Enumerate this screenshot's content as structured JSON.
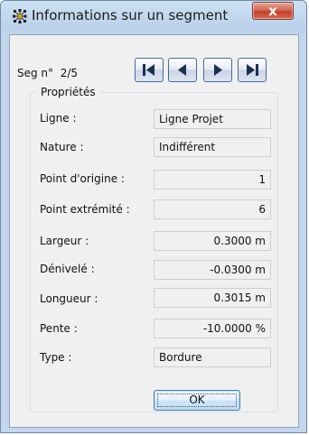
{
  "window": {
    "title": "Informations sur un segment",
    "close_label": "x"
  },
  "segment": {
    "label": "Seg n°",
    "position": "2/5"
  },
  "group_title": "Propriétés",
  "properties": [
    {
      "label": "Ligne :",
      "value": "Ligne Projet",
      "align": "left"
    },
    {
      "label": "Nature :",
      "value": "Indifférent",
      "align": "left"
    },
    {
      "label": "Point d'origine :",
      "value": "1",
      "align": "right"
    },
    {
      "label": "Point extrémité :",
      "value": "6",
      "align": "right"
    },
    {
      "label": "Largeur :",
      "value": "0.3000 m",
      "align": "right"
    },
    {
      "label": "Dénivelé :",
      "value": "-0.0300 m",
      "align": "right"
    },
    {
      "label": "Longueur :",
      "value": "0.3015 m",
      "align": "right"
    },
    {
      "label": "Pente :",
      "value": "-10.0000 %",
      "align": "right"
    },
    {
      "label": "Type :",
      "value": "Bordure",
      "align": "left"
    }
  ],
  "ok_label": "OK"
}
